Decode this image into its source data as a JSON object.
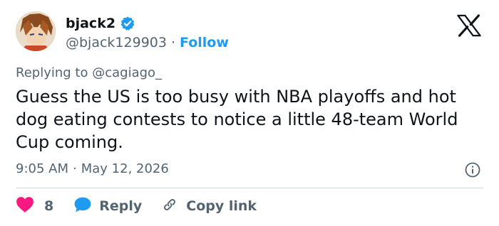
{
  "user": {
    "display_name": "bjack2",
    "handle": "@bjack129903",
    "separator": "·",
    "follow_label": "Follow",
    "verified": true
  },
  "tweet": {
    "reply_prefix": "Replying to",
    "reply_to": "@cagiago_",
    "text": "Guess the US is too busy with NBA playoffs and hot dog eating contests to notice a little 48-team World Cup coming.",
    "time": "9:05 AM",
    "date_separator": "·",
    "date": "May 12, 2026"
  },
  "actions": {
    "like_count": "8",
    "reply_label": "Reply",
    "copy_link_label": "Copy link"
  },
  "colors": {
    "accent": "#1d9bf0",
    "like": "#f91880",
    "muted": "#536471",
    "text": "#0f1419"
  },
  "icons": [
    "verified-badge-icon",
    "x-logo-icon",
    "info-icon",
    "heart-icon",
    "reply-bubble-icon",
    "link-icon"
  ]
}
